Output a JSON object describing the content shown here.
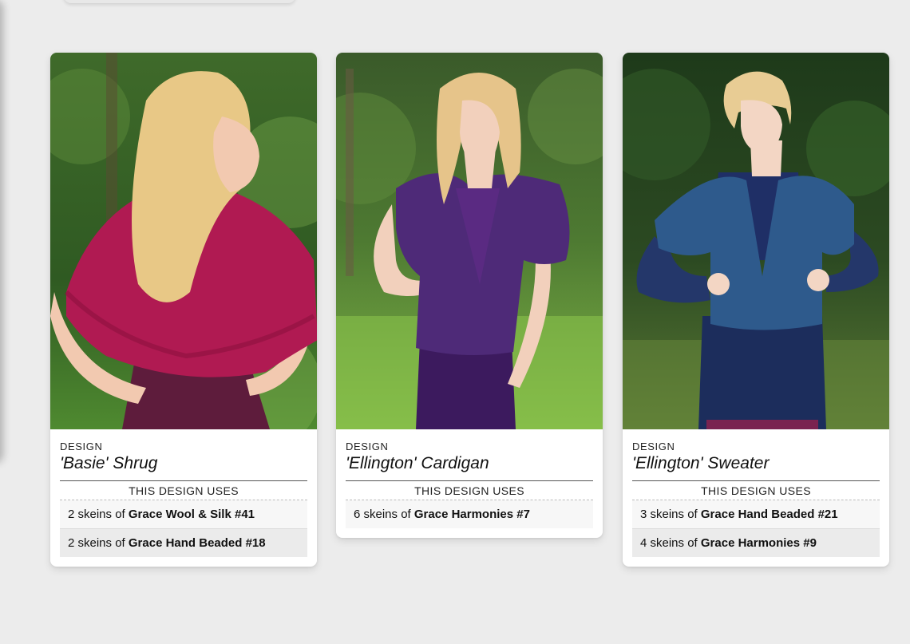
{
  "colors": {
    "background": "#ececec",
    "card": "#ffffff",
    "row_light": "#f7f7f7",
    "row_dark": "#ebebeb"
  },
  "cards": [
    {
      "kicker": "DESIGN",
      "title": "'Basie' Shrug",
      "uses_label": "THIS DESIGN USES",
      "photo": "model-back-view-magenta-shrug",
      "garment_color": "#b01a52",
      "yarns": [
        {
          "qty": "2 skeins of ",
          "name": "Grace Wool & Silk #41"
        },
        {
          "qty": "2 skeins of ",
          "name": "Grace Hand Beaded #18"
        }
      ]
    },
    {
      "kicker": "DESIGN",
      "title": "'Ellington' Cardigan",
      "uses_label": "THIS DESIGN USES",
      "photo": "model-purple-cardigan",
      "garment_color": "#4e2a78",
      "yarns": [
        {
          "qty": "6 skeins of ",
          "name": "Grace Harmonies #7"
        }
      ]
    },
    {
      "kicker": "DESIGN",
      "title": "'Ellington' Sweater",
      "uses_label": "THIS DESIGN USES",
      "photo": "model-blue-sweater",
      "garment_color": "#2e5a8c",
      "yarns": [
        {
          "qty": "3 skeins of ",
          "name": "Grace Hand Beaded #21"
        },
        {
          "qty": "4 skeins of ",
          "name": "Grace Harmonies #9"
        }
      ]
    }
  ]
}
